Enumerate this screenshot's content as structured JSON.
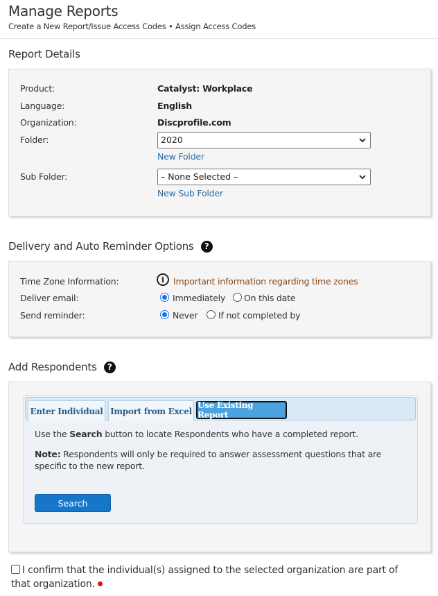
{
  "header": {
    "title": "Manage Reports",
    "subtitle": "Create a New Report/Issue Access Codes • Assign Access Codes"
  },
  "report_details": {
    "title": "Report Details",
    "product_label": "Product:",
    "product_value": "Catalyst: Workplace",
    "language_label": "Language:",
    "language_value": "English",
    "organization_label": "Organization:",
    "organization_value": "Discprofile.com",
    "folder_label": "Folder:",
    "folder_value": "2020",
    "new_folder_link": "New Folder",
    "sub_folder_label": "Sub Folder:",
    "sub_folder_value": "– None Selected –",
    "new_sub_folder_link": "New Sub Folder"
  },
  "delivery": {
    "title": "Delivery and Auto Reminder Options",
    "time_zone_label": "Time Zone Information:",
    "time_zone_info": "Important information regarding time zones",
    "deliver_email_label": "Deliver email:",
    "deliver_immediately": "Immediately",
    "deliver_on_date": "On this date",
    "deliver_selected": "Immediately",
    "send_reminder_label": "Send reminder:",
    "reminder_never": "Never",
    "reminder_if_not_completed": "If not completed by",
    "reminder_selected": "Never"
  },
  "respondents": {
    "title": "Add Respondents",
    "tabs": [
      {
        "label": "Enter Individual",
        "active": false
      },
      {
        "label": "Import from Excel",
        "active": false
      },
      {
        "label": "Use Existing Report",
        "active": true
      }
    ],
    "instruction_prefix": "Use the ",
    "instruction_bold": "Search",
    "instruction_suffix": " button to locate Respondents who have a completed report.",
    "note_bold": "Note:",
    "note_text": " Respondents will only be required to answer assessment questions that are specific to the new report.",
    "search_button": "Search"
  },
  "confirm": {
    "text": "I confirm that the individual(s) assigned to the selected organization are part of that organization.",
    "checked": false
  },
  "colors": {
    "accent_blue": "#1676c9",
    "link_blue": "#2e6da4",
    "info_text": "#8a4a1a",
    "required_red": "#d9141b"
  }
}
